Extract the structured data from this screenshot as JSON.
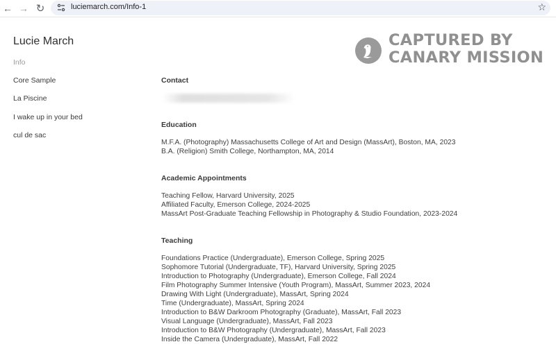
{
  "browser": {
    "url": "luciemarch.com/Info-1"
  },
  "site": {
    "title": "Lucie March",
    "nav": [
      {
        "label": "Info",
        "active": true
      },
      {
        "label": "Core Sample",
        "active": false
      },
      {
        "label": "La Piscine",
        "active": false
      },
      {
        "label": "I wake up in your bed",
        "active": false
      },
      {
        "label": "cul de sac",
        "active": false
      }
    ]
  },
  "watermark": {
    "line1": "CAPTURED BY",
    "line2": "CANARY MISSION",
    "color": "#909090"
  },
  "contact": {
    "heading": "Contact"
  },
  "education": {
    "heading": "Education",
    "items": [
      "M.F.A. (Photography) Massachusetts College of Art and Design (MassArt), Boston, MA, 2023",
      "B.A. (Religion) Smith College, Northampton, MA, 2014"
    ]
  },
  "appointments": {
    "heading": "Academic Appointments",
    "items": [
      "Teaching Fellow, Harvard University, 2025",
      "Affiliated Faculty, Emerson College, 2024-2025",
      "MassArt Post-Graduate Teaching Fellowship in Photography & Studio Foundation, 2023-2024"
    ]
  },
  "teaching": {
    "heading": "Teaching",
    "items": [
      "Foundations Practice (Undergraduate), Emerson College, Spring 2025",
      "Sophomore Tutorial (Undergraduate, TF), Harvard University, Spring 2025",
      "Introduction to Photography (Undergraduate), Emerson College, Fall 2024",
      "Film Photography Summer Intensive (Youth Program), MassArt, Summer 2023, 2024",
      "Drawing With Light (Undergraduate), MassArt, Spring 2024",
      "Time (Undergraduate), MassArt, Spring 2024",
      "Introduction to B&W Darkroom Photography (Graduate), MassArt, Fall 2023",
      "Visual Language (Undergraduate), MassArt, Fall 2023",
      "Introduction to B&W Photography (Undergraduate), MassArt, Fall 2023",
      "Inside the Camera (Undergraduate), MassArt, Fall 2022"
    ]
  }
}
